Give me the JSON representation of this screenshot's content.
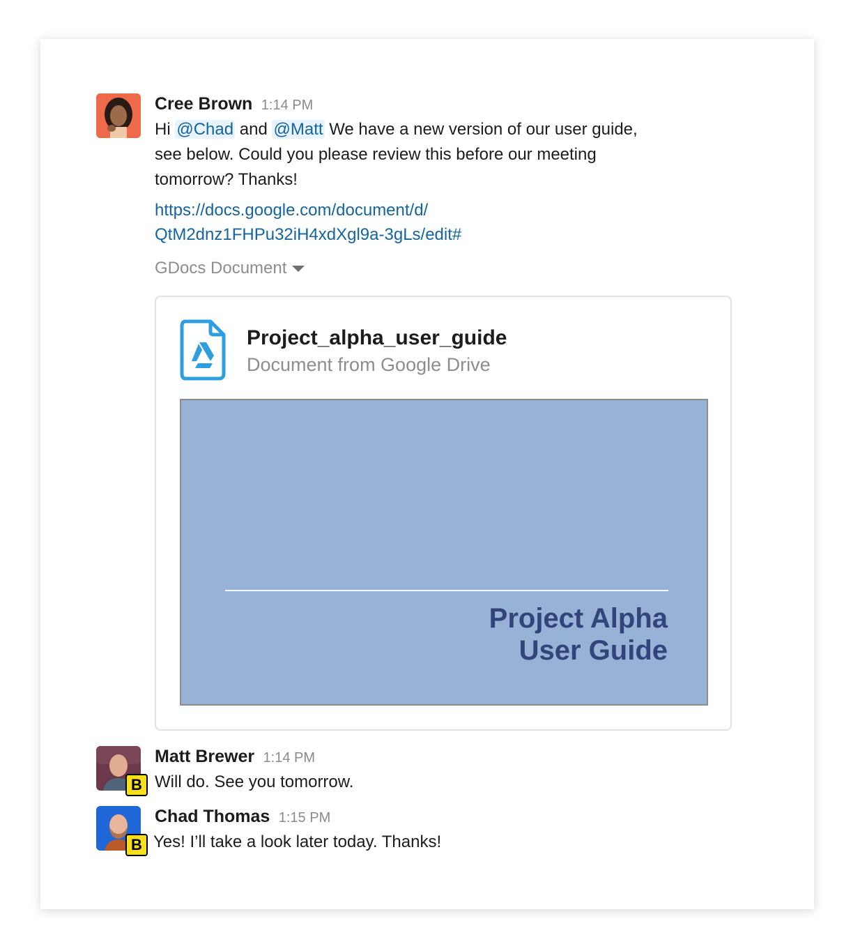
{
  "messages": [
    {
      "author": "Cree Brown",
      "time": "1:14 PM",
      "text_pre": "Hi ",
      "mention1": "@Chad",
      "text_mid": " and ",
      "mention2": "@Matt",
      "text_post": "  We have a new version of our user guide, see below. Could you please review this before our meeting tomorrow? Thanks!",
      "link_line1": "https://docs.google.com/document/d/",
      "link_line2": "QtM2dnz1FHPu32iH4xdXgl9a-3gLs/edit#",
      "unfurl_label": "GDocs Document",
      "attachment": {
        "title": "Project_alpha_user_guide",
        "subtitle": "Document from Google Drive",
        "preview_line1": "Project Alpha",
        "preview_line2": "User Guide"
      }
    },
    {
      "author": "Matt Brewer",
      "time": "1:14 PM",
      "text": "Will do. See you tomorrow.",
      "badge": "B"
    },
    {
      "author": "Chad Thomas",
      "time": "1:15 PM",
      "text": "Yes! I’ll take a look later today. Thanks!",
      "badge": "B"
    }
  ],
  "colors": {
    "mention": "#1264a3",
    "link": "#1264a3",
    "preview_bg": "#97b2d6",
    "preview_text": "#33447a",
    "drive_icon": "#2d9fe0",
    "badge_bg": "#f7df1e"
  }
}
